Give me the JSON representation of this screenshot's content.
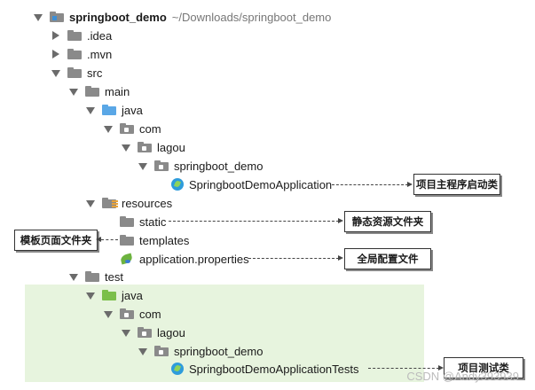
{
  "tree": {
    "root_name": "springboot_demo",
    "root_path": "~/Downloads/springboot_demo",
    "idea": ".idea",
    "mvn": ".mvn",
    "src": "src",
    "main": "main",
    "main_java": "java",
    "main_com": "com",
    "main_lagou": "lagou",
    "main_pkg": "springboot_demo",
    "main_app": "SpringbootDemoApplication",
    "resources": "resources",
    "static": "static",
    "templates": "templates",
    "properties": "application.properties",
    "test": "test",
    "test_java": "java",
    "test_com": "com",
    "test_lagou": "lagou",
    "test_pkg": "springboot_demo",
    "test_app": "SpringbootDemoApplicationTests"
  },
  "callouts": {
    "main_class": "项目主程序启动类",
    "static_dir": "静态资源文件夹",
    "templates_dir": "模板页面文件夹",
    "config_file": "全局配置文件",
    "test_class": "项目测试类"
  },
  "watermark": "CSDN @Andy393939",
  "colors": {
    "folder_gray": "#8a8a8a",
    "folder_blue": "#5aa7e6",
    "folder_green": "#7bbf4a",
    "test_highlight": "#e7f4de"
  }
}
